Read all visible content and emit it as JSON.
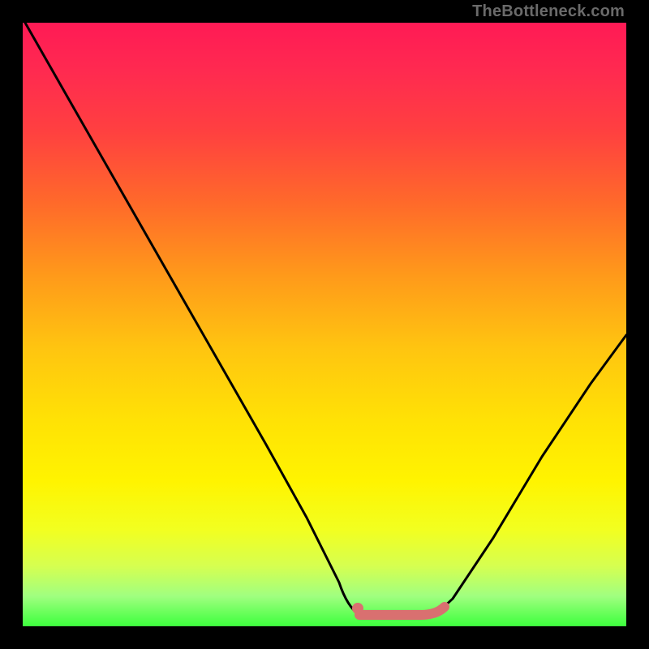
{
  "watermark": "TheBottleneck.com",
  "colors": {
    "background": "#000000",
    "curve": "#000000",
    "marker": "#d97070"
  },
  "chart_data": {
    "type": "line",
    "title": "",
    "xlabel": "",
    "ylabel": "",
    "annotations": [],
    "x": [
      0.0,
      0.05,
      0.1,
      0.15,
      0.2,
      0.25,
      0.3,
      0.35,
      0.4,
      0.45,
      0.5,
      0.53,
      0.56,
      0.6,
      0.66,
      0.7,
      0.75,
      0.8,
      0.85,
      0.9,
      0.95,
      1.0
    ],
    "values": [
      1.0,
      0.9,
      0.8,
      0.7,
      0.6,
      0.5,
      0.4,
      0.3,
      0.2,
      0.1,
      0.03,
      0.0,
      0.0,
      0.0,
      0.0,
      0.02,
      0.08,
      0.17,
      0.27,
      0.37,
      0.46,
      0.53
    ],
    "flat_segment": {
      "x_start": 0.53,
      "x_end": 0.66,
      "y": 0.0
    },
    "marker": {
      "x": 0.53,
      "y": 0.01
    },
    "xlim": [
      0,
      1
    ],
    "ylim": [
      0,
      1
    ],
    "grid": false,
    "legend": false
  }
}
